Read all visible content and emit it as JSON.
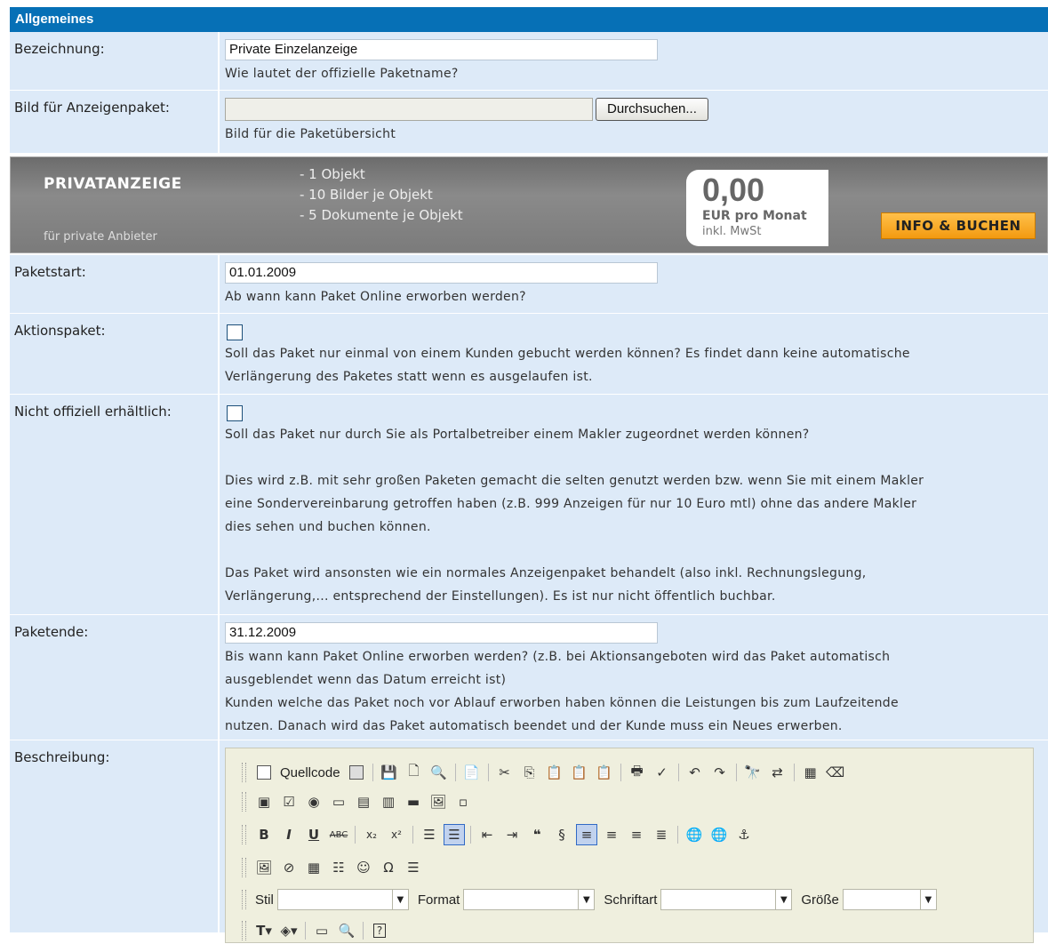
{
  "section_title": "Allgemeines",
  "fields": {
    "bezeichnung": {
      "label": "Bezeichnung:",
      "value": "Private Einzelanzeige",
      "hint": "Wie lautet der offizielle Paketname?"
    },
    "bild": {
      "label": "Bild für Anzeigenpaket:",
      "button": "Durchsuchen...",
      "hint": "Bild für die Paketübersicht"
    },
    "paketstart": {
      "label": "Paketstart:",
      "value": "01.01.2009",
      "hint": "Ab wann kann Paket Online erworben werden?"
    },
    "aktionspaket": {
      "label": "Aktionspaket:",
      "hint1": "Soll das Paket nur einmal von einem Kunden gebucht werden können? Es findet dann keine automatische",
      "hint2": "Verlängerung des Paketes statt wenn es ausgelaufen ist."
    },
    "nicht_offiziell": {
      "label": "Nicht offiziell erhältlich:",
      "hint1": "Soll das Paket nur durch Sie als Portalbetreiber einem Makler zugeordnet werden können?",
      "hint2": "Dies wird z.B. mit sehr großen Paketen gemacht die selten genutzt werden bzw. wenn Sie mit einem Makler",
      "hint3": "eine Sondervereinbarung getroffen haben (z.B. 999 Anzeigen für nur 10 Euro mtl) ohne das andere Makler",
      "hint4": "dies sehen und buchen können.",
      "hint5": "Das Paket wird ansonsten wie ein normales Anzeigenpaket behandelt (also inkl. Rechnungslegung,",
      "hint6": "Verlängerung,... entsprechend der Einstellungen). Es ist nur nicht öffentlich buchbar."
    },
    "paketende": {
      "label": "Paketende:",
      "value": "31.12.2009",
      "hint1": "Bis wann kann Paket Online erworben werden? (z.B. bei Aktionsangeboten wird das Paket automatisch",
      "hint2": "ausgeblendet wenn das Datum erreicht ist)",
      "hint3": "Kunden welche das Paket noch vor Ablauf erworben haben können die Leistungen bis zum Laufzeitende",
      "hint4": "nutzen. Danach wird das Paket automatisch beendet und der Kunde muss ein Neues erwerben."
    },
    "beschreibung": {
      "label": "Beschreibung:"
    }
  },
  "banner": {
    "title": "PRIVATANZEIGE",
    "subtitle": "für private Anbieter",
    "features": [
      "- 1 Objekt",
      "- 10 Bilder je Objekt",
      "- 5 Dokumente je Objekt"
    ],
    "price": "0,00",
    "price_unit": "EUR pro Monat",
    "price_tax": "inkl. MwSt",
    "button": "INFO & BUCHEN"
  },
  "editor": {
    "source_label": "Quellcode",
    "style_label": "Stil",
    "format_label": "Format",
    "font_label": "Schriftart",
    "size_label": "Größe"
  }
}
